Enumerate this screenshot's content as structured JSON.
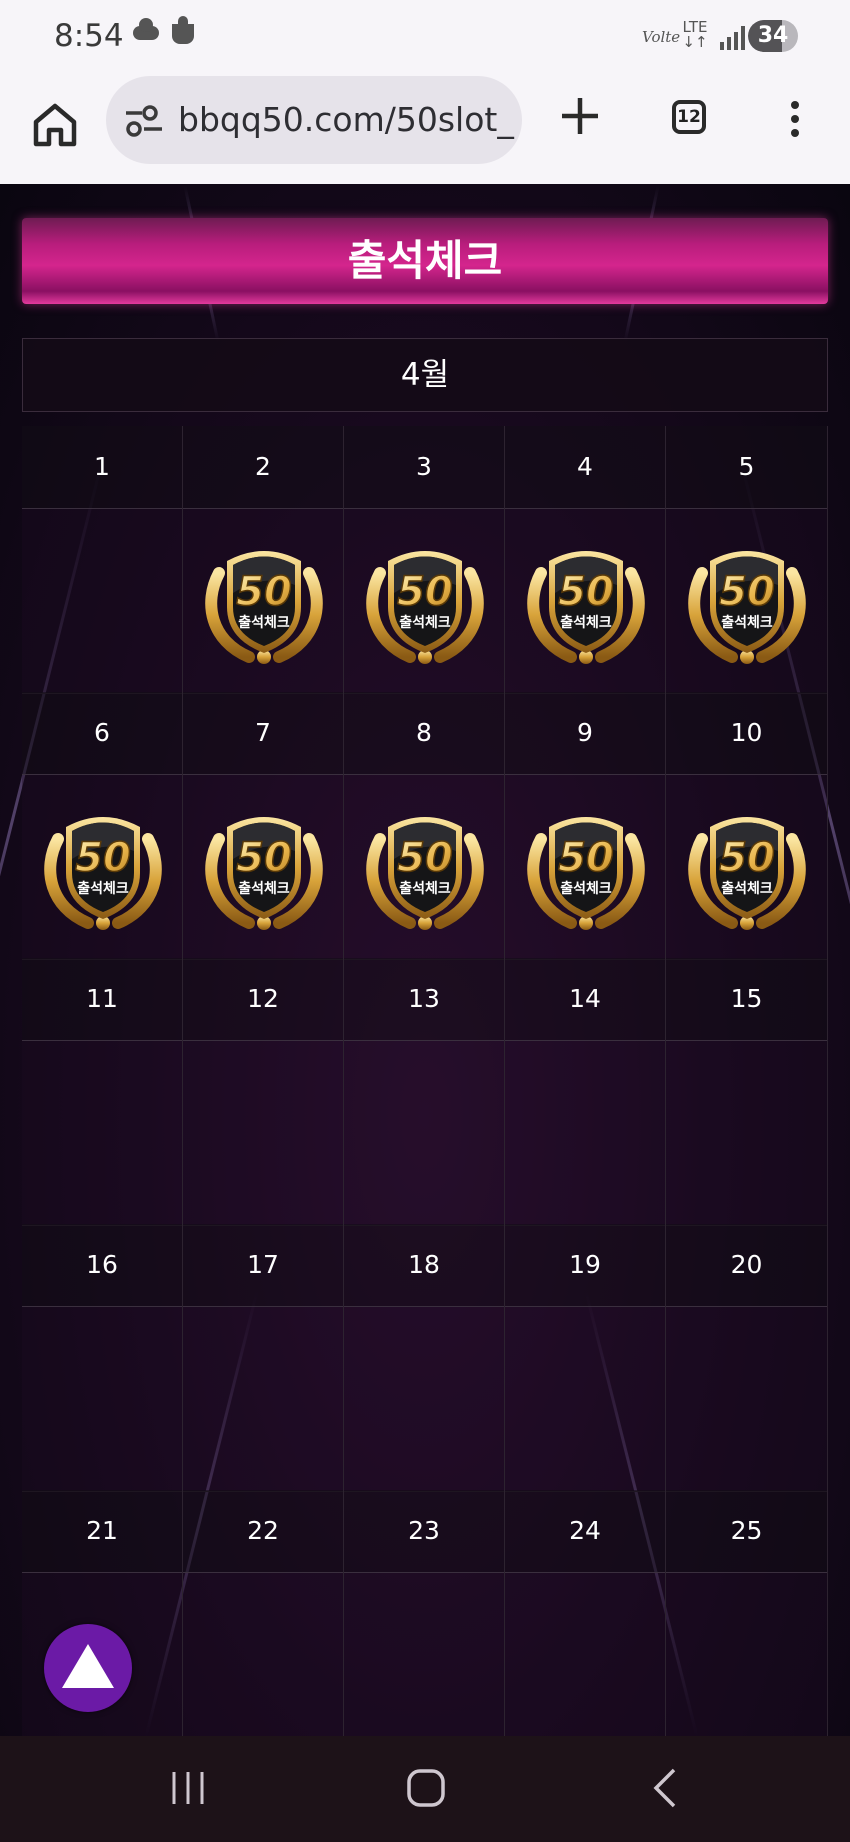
{
  "status_bar": {
    "time": "8:54",
    "volte": "Volte",
    "network": "LTE",
    "battery": "34"
  },
  "browser": {
    "url": "bbqq50.com/50slot_",
    "tab_count": "12"
  },
  "page": {
    "title": "출석체크",
    "month": "4월",
    "badge_number": "50",
    "badge_caption": "출석체크",
    "days": [
      {
        "label": "1",
        "checked": false
      },
      {
        "label": "2",
        "checked": true
      },
      {
        "label": "3",
        "checked": true
      },
      {
        "label": "4",
        "checked": true
      },
      {
        "label": "5",
        "checked": true
      },
      {
        "label": "6",
        "checked": true
      },
      {
        "label": "7",
        "checked": true
      },
      {
        "label": "8",
        "checked": true
      },
      {
        "label": "9",
        "checked": true
      },
      {
        "label": "10",
        "checked": true
      },
      {
        "label": "11",
        "checked": false
      },
      {
        "label": "12",
        "checked": false
      },
      {
        "label": "13",
        "checked": false
      },
      {
        "label": "14",
        "checked": false
      },
      {
        "label": "15",
        "checked": false
      },
      {
        "label": "16",
        "checked": false
      },
      {
        "label": "17",
        "checked": false
      },
      {
        "label": "18",
        "checked": false
      },
      {
        "label": "19",
        "checked": false
      },
      {
        "label": "20",
        "checked": false
      },
      {
        "label": "21",
        "checked": false
      },
      {
        "label": "22",
        "checked": false
      },
      {
        "label": "23",
        "checked": false
      },
      {
        "label": "24",
        "checked": false
      },
      {
        "label": "25",
        "checked": false
      }
    ]
  },
  "colors": {
    "title_pink": "#d4258d",
    "fab_purple": "#6b1aa6",
    "gold": "#e8b44a"
  }
}
